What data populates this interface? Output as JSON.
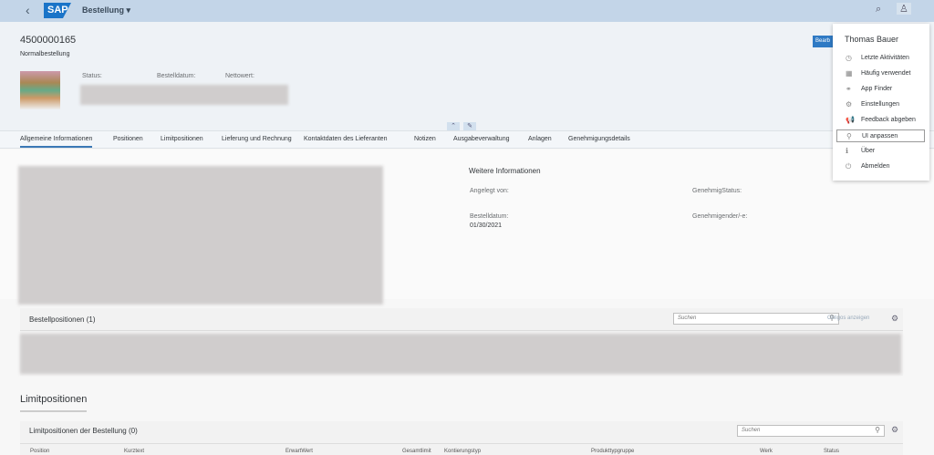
{
  "shell": {
    "app_title": "Bestellung ▾",
    "logo": "SAP",
    "back": "‹",
    "search_icon": "⌕",
    "user_icon": "♙"
  },
  "header": {
    "id": "4500000165",
    "type": "Normalbestellung",
    "labels": {
      "status": "Status:",
      "date": "Bestelldatum:",
      "net": "Nettowert:"
    },
    "edit_button": "Bearb"
  },
  "tabs": [
    "Allgemeine Informationen",
    "Positionen",
    "Limitpositionen",
    "Lieferung und Rechnung",
    "Kontaktdaten des Lieferanten",
    "Notizen",
    "Ausgabeverwaltung",
    "Anlagen",
    "Genehmigungsdetails"
  ],
  "info": {
    "title": "Weitere Informationen",
    "created_by": "Angelegt von:",
    "approval_status": "GenehmigStatus:",
    "order_date_label": "Bestelldatum:",
    "order_date": "01/30/2021",
    "approver": "Genehmigender/-e:"
  },
  "items": {
    "title": "Bestellpositionen (1)",
    "search_placeholder": "Suchen",
    "obligo": "Obligos anzeigen"
  },
  "limits": {
    "section": "Limitpositionen",
    "title": "Limitpositionen der Bestellung (0)",
    "search_placeholder": "Suchen",
    "columns": [
      "Position",
      "Kurztext",
      "ErwartWert",
      "Gesamtlimit",
      "Kontierungstyp",
      "Produkttypgruppe",
      "Werk",
      "Status"
    ]
  },
  "menu": {
    "user": "Thomas Bauer",
    "items": [
      {
        "label": "Letzte Aktivitäten",
        "icon": "◷"
      },
      {
        "label": "Häufig verwendet",
        "icon": "▦"
      },
      {
        "label": "App Finder",
        "icon": "⚭"
      },
      {
        "label": "Einstellungen",
        "icon": "⚙"
      },
      {
        "label": "Feedback abgeben",
        "icon": "📢"
      },
      {
        "label": "UI anpassen",
        "icon": "⚲"
      },
      {
        "label": "Über",
        "icon": "ℹ"
      },
      {
        "label": "Abmelden",
        "icon": "⏻"
      }
    ]
  }
}
